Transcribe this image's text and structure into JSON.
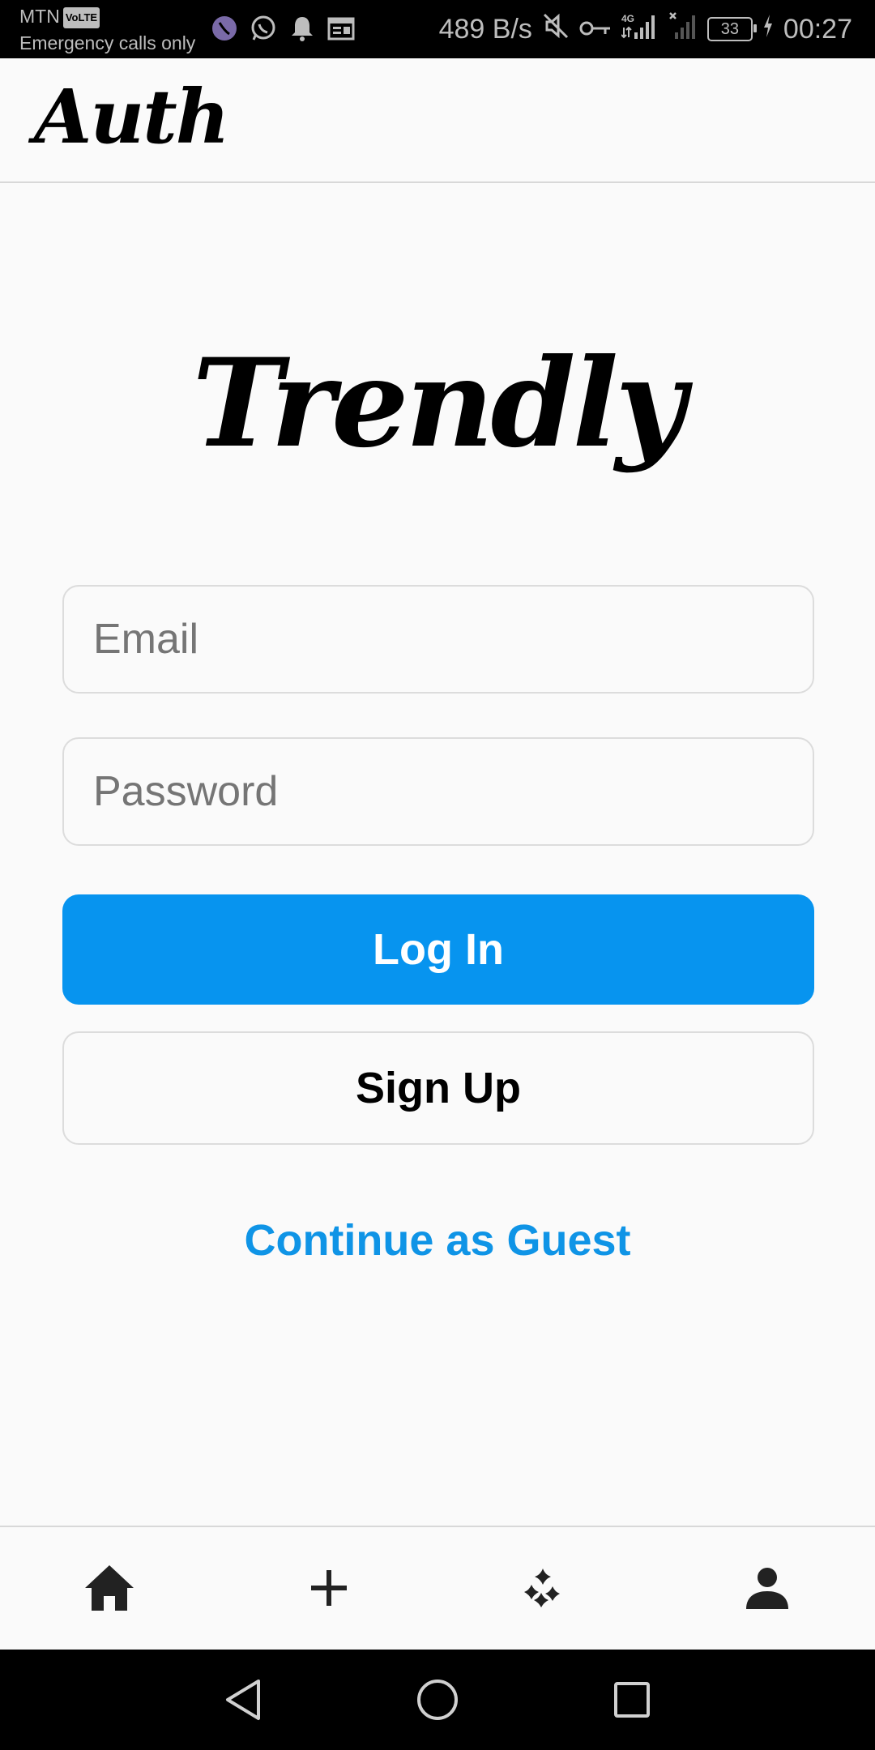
{
  "status_bar": {
    "carrier": "MTN",
    "volte_badge": "VoLTE",
    "emergency": "Emergency calls only",
    "net_speed": "489 B/s",
    "network_type": "4G",
    "battery": "33",
    "time": "00:27",
    "icons": [
      "viber-icon",
      "whatsapp-icon",
      "bell-icon",
      "calendar-icon",
      "mute-icon",
      "key-icon",
      "signal-icon",
      "no-signal-icon",
      "battery-icon",
      "charging-icon"
    ]
  },
  "header": {
    "title": "Auth"
  },
  "logo": {
    "text": "Trendly"
  },
  "form": {
    "email_placeholder": "Email",
    "email_value": "",
    "password_placeholder": "Password",
    "password_value": "",
    "login_label": "Log In",
    "signup_label": "Sign Up",
    "guest_label": "Continue as Guest"
  },
  "tabs": [
    "home-icon",
    "add-icon",
    "explore-icon",
    "profile-icon"
  ],
  "nav": [
    "back-icon",
    "home-circle-icon",
    "recents-icon"
  ],
  "colors": {
    "primary": "#0794EF",
    "link": "#0F94E6",
    "background": "#FAFAFA",
    "border": "#DCDCDC"
  }
}
